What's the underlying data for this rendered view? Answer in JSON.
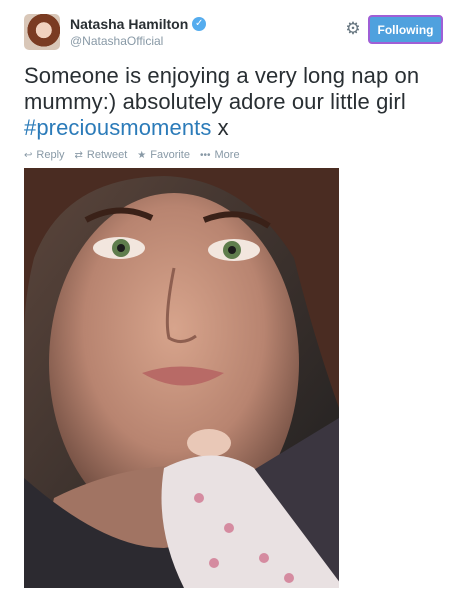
{
  "user": {
    "name": "Natasha Hamilton",
    "handle": "@NatashaOfficial",
    "verified_icon": "verified-badge-icon"
  },
  "header": {
    "settings_icon": "gear-icon",
    "follow_label": "Following"
  },
  "tweet": {
    "text_before": "Someone is enjoying a very long nap on mummy:) absolutely adore our little girl ",
    "hashtag": "#preciousmoments",
    "text_after": " x"
  },
  "actions": {
    "reply": "Reply",
    "retweet": "Retweet",
    "favorite": "Favorite",
    "more": "More"
  },
  "colors": {
    "accent": "#55acee",
    "hashtag": "#2b7bb9",
    "follow_button": "#4fa1de",
    "follow_border": "#9f5fd6"
  }
}
